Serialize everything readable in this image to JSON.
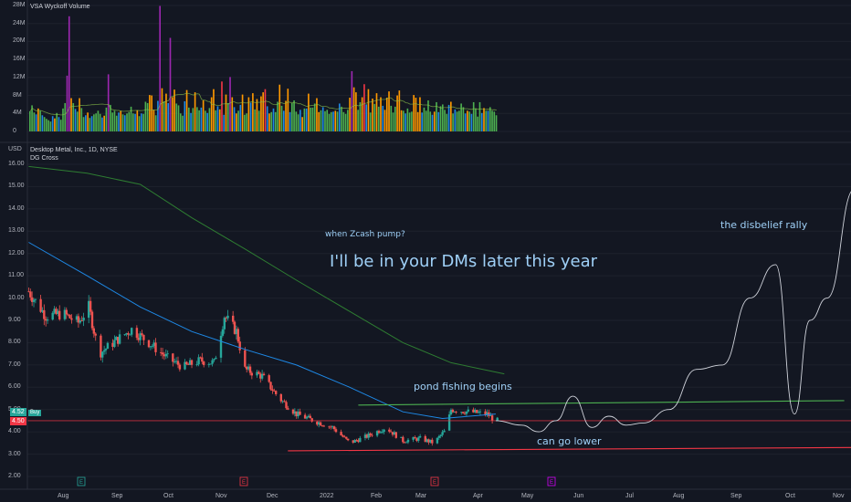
{
  "volume_pane": {
    "title": "VSA Wyckoff Volume",
    "ticks": [
      "28M",
      "24M",
      "20M",
      "16M",
      "12M",
      "8M",
      "4M",
      "0"
    ]
  },
  "price_pane": {
    "currency": "USD",
    "title": "Desktop Metal, Inc., 1D, NYSE",
    "indicator": "DG Cross",
    "ticks": [
      "16.00",
      "15.00",
      "14.00",
      "13.00",
      "12.00",
      "11.00",
      "10.00",
      "9.00",
      "8.00",
      "7.00",
      "6.00",
      "5.00",
      "4.00",
      "3.00",
      "2.00"
    ],
    "current_price": "4.52",
    "current_price_sub": "Buy",
    "level_price": "4.50"
  },
  "time_axis": [
    "Aug",
    "Sep",
    "Oct",
    "Nov",
    "Dec",
    "2022",
    "Feb",
    "Mar",
    "Apr",
    "May",
    "Jun",
    "Jul",
    "Aug",
    "Sep",
    "Oct",
    "Nov"
  ],
  "event_markers": [
    "E",
    "E",
    "E",
    "E"
  ],
  "annotations": {
    "zcash": "when Zcash pump?",
    "dms": "I'll be in your  DMs later this year",
    "disbelief": "the disbelief rally",
    "pond": "pond fishing begins",
    "lower": "can go lower"
  },
  "chart_data": {
    "type": "line",
    "title": "Desktop Metal, Inc., 1D, NYSE",
    "ylabel": "USD",
    "ylim": [
      1.5,
      16.5
    ],
    "y_scale": "linear",
    "x_range": [
      "2021-07-12",
      "2022-11-15"
    ],
    "price_path": [
      [
        "2021-07-12",
        10.3
      ],
      [
        "2021-07-22",
        9.2
      ],
      [
        "2021-08-01",
        9.3
      ],
      [
        "2021-08-10",
        8.9
      ],
      [
        "2021-08-16",
        9.6
      ],
      [
        "2021-08-22",
        7.5
      ],
      [
        "2021-09-01",
        8.1
      ],
      [
        "2021-09-10",
        8.6
      ],
      [
        "2021-09-20",
        8.0
      ],
      [
        "2021-10-01",
        7.3
      ],
      [
        "2021-10-10",
        6.9
      ],
      [
        "2021-10-20",
        7.2
      ],
      [
        "2021-10-28",
        7.1
      ],
      [
        "2021-11-03",
        9.2
      ],
      [
        "2021-11-10",
        8.5
      ],
      [
        "2021-11-15",
        6.8
      ],
      [
        "2021-11-25",
        6.5
      ],
      [
        "2021-12-05",
        5.5
      ],
      [
        "2021-12-15",
        4.8
      ],
      [
        "2021-12-25",
        4.5
      ],
      [
        "2022-01-05",
        4.2
      ],
      [
        "2022-01-15",
        3.5
      ],
      [
        "2022-01-25",
        3.8
      ],
      [
        "2022-02-05",
        4.2
      ],
      [
        "2022-02-15",
        3.6
      ],
      [
        "2022-02-25",
        3.7
      ],
      [
        "2022-03-05",
        3.5
      ],
      [
        "2022-03-12",
        4.1
      ],
      [
        "2022-03-15",
        5.0
      ],
      [
        "2022-03-25",
        4.9
      ],
      [
        "2022-04-05",
        4.8
      ],
      [
        "2022-04-10",
        4.5
      ]
    ],
    "projection_path": [
      [
        "2022-04-10",
        4.5
      ],
      [
        "2022-04-25",
        4.3
      ],
      [
        "2022-05-05",
        4.0
      ],
      [
        "2022-05-15",
        4.5
      ],
      [
        "2022-05-25",
        5.6
      ],
      [
        "2022-06-05",
        4.2
      ],
      [
        "2022-06-15",
        4.7
      ],
      [
        "2022-06-25",
        4.3
      ],
      [
        "2022-07-05",
        4.4
      ],
      [
        "2022-07-20",
        5.0
      ],
      [
        "2022-08-05",
        6.8
      ],
      [
        "2022-08-20",
        7.0
      ],
      [
        "2022-09-05",
        10.0
      ],
      [
        "2022-09-20",
        11.5
      ],
      [
        "2022-10-01",
        4.8
      ],
      [
        "2022-10-10",
        9.0
      ],
      [
        "2022-10-20",
        10.0
      ],
      [
        "2022-11-05",
        14.9
      ]
    ],
    "series": [
      {
        "name": "DG Cross",
        "color": "#1e88e5",
        "points": [
          [
            "2021-07-12",
            12.5
          ],
          [
            "2021-08-15",
            11.0
          ],
          [
            "2021-09-15",
            9.6
          ],
          [
            "2021-10-15",
            8.5
          ],
          [
            "2021-11-15",
            7.7
          ],
          [
            "2021-12-15",
            7.0
          ],
          [
            "2022-01-15",
            6.0
          ],
          [
            "2022-02-15",
            4.9
          ],
          [
            "2022-03-10",
            4.6
          ],
          [
            "2022-04-10",
            4.8
          ]
        ]
      },
      {
        "name": "",
        "color": "#2e7d32",
        "points": [
          [
            "2021-07-12",
            15.9
          ],
          [
            "2021-08-15",
            15.6
          ],
          [
            "2021-09-15",
            15.1
          ],
          [
            "2021-10-15",
            13.6
          ],
          [
            "2021-11-15",
            12.2
          ],
          [
            "2021-12-15",
            10.8
          ],
          [
            "2022-01-15",
            9.4
          ],
          [
            "2022-02-15",
            8.0
          ],
          [
            "2022-03-15",
            7.1
          ],
          [
            "2022-04-15",
            6.6
          ]
        ]
      }
    ],
    "support_line": {
      "color": "#f23645",
      "points": [
        [
          "2021-12-10",
          3.15
        ],
        [
          "2022-11-10",
          3.3
        ]
      ]
    },
    "resistance_line": {
      "color": "#4caf50",
      "points": [
        [
          "2022-01-20",
          5.2
        ],
        [
          "2022-10-30",
          5.4
        ]
      ]
    },
    "horizontal_level": 4.5,
    "volume": {
      "ylim": [
        0,
        28
      ],
      "unit": "M",
      "values": [
        4.5,
        5.8,
        4.2,
        3.8,
        5.1,
        4.6,
        3.6,
        3.2,
        2.8,
        2.5,
        2.2,
        3.4,
        2.9,
        4.1,
        3.2,
        2.6,
        5.1,
        6.3,
        12.4,
        25.6,
        7.4,
        6.3,
        5.0,
        4.4,
        7.4,
        5.2,
        3.2,
        3.6,
        4.2,
        3.0,
        3.4,
        3.8,
        4.0,
        4.6,
        3.9,
        3.1,
        3.5,
        5.3,
        12.7,
        5.9,
        4.2,
        4.6,
        3.5,
        4.2,
        4.6,
        3.8,
        3.6,
        4.0,
        4.3,
        5.5,
        4.0,
        3.9,
        4.7,
        3.4,
        4.0,
        3.9,
        6.6,
        6.3,
        8.1,
        8.0,
        4.8,
        3.6,
        6.8,
        27.9,
        9.6,
        6.7,
        8.4,
        6.3,
        20.8,
        7.6,
        9.3,
        6.2,
        5.8,
        4.0,
        3.5,
        6.7,
        9.2,
        5.3,
        4.1,
        5.2,
        8.7,
        5.4,
        4.7,
        5.3,
        6.9,
        4.6,
        4.1,
        5.2,
        7.6,
        9.4,
        4.7,
        5.6,
        4.9,
        11.1,
        3.7,
        8.2,
        6.3,
        12.1,
        7.6,
        5.4,
        4.0,
        4.6,
        5.9,
        8.2,
        3.7,
        4.0,
        7.6,
        6.4,
        8.5,
        4.9,
        7.2,
        4.6,
        7.8,
        8.7,
        9.4,
        5.6,
        4.0,
        4.3,
        5.1,
        4.3,
        6.6,
        10.4,
        5.7,
        4.6,
        6.8,
        9.5,
        4.3,
        6.3,
        6.9,
        4.4,
        3.8,
        4.8,
        3.2,
        5.1,
        5.1,
        8.4,
        5.3,
        5.3,
        6.2,
        7.4,
        4.3,
        4.7,
        5.4,
        4.5,
        4.8,
        3.9,
        4.3,
        4.4,
        4.6,
        4.4,
        6.2,
        5.5,
        4.3,
        3.9,
        4.8,
        7.5,
        13.4,
        9.8,
        8.7,
        4.8,
        6.5,
        7.6,
        10.5,
        6.0,
        9.4,
        4.2,
        7.3,
        6.1,
        8.5,
        5.5,
        7.6,
        5.7,
        4.8,
        7.5,
        8.9,
        5.7,
        4.2,
        5.5,
        8.0,
        9.1,
        4.7,
        4.6,
        4.0,
        5.1,
        4.2,
        4.4,
        8.1,
        7.5,
        4.3,
        7.6,
        4.2,
        5.3,
        4.6,
        6.9,
        4.4,
        3.7,
        4.4,
        6.5,
        4.3,
        5.6,
        6.0,
        4.8,
        3.9,
        5.9,
        6.6,
        4.0,
        4.9,
        4.4,
        4.6,
        6.2,
        5.4,
        4.0,
        4.6,
        4.4,
        3.9,
        6.5,
        5.1,
        3.3,
        6.5,
        4.1,
        5.2,
        4.6,
        4.6,
        5.4,
        4.6,
        4.4,
        3.6
      ]
    }
  },
  "colors": {
    "background": "#131722",
    "candle_up": "#26a69a",
    "candle_down": "#ef5350",
    "vol_green": "#4caf50",
    "vol_orange": "#ff9800",
    "vol_purple": "#9c27b0",
    "vol_blue": "#1e88e5",
    "vol_red": "#f23645"
  }
}
